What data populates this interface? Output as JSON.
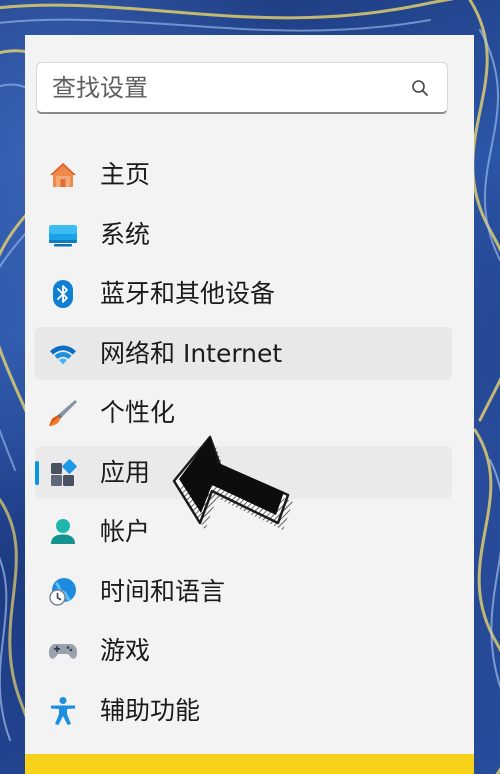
{
  "search": {
    "placeholder": "查找设置"
  },
  "nav": {
    "items": [
      {
        "id": "home",
        "label": "主页",
        "icon": "home-icon"
      },
      {
        "id": "system",
        "label": "系统",
        "icon": "system-display-icon"
      },
      {
        "id": "bluetooth",
        "label": "蓝牙和其他设备",
        "icon": "bluetooth-icon"
      },
      {
        "id": "network",
        "label": "网络和 Internet",
        "icon": "wifi-icon",
        "state": "hover"
      },
      {
        "id": "personalization",
        "label": "个性化",
        "icon": "paintbrush-icon"
      },
      {
        "id": "apps",
        "label": "应用",
        "icon": "apps-icon",
        "state": "selected"
      },
      {
        "id": "accounts",
        "label": "帐户",
        "icon": "account-icon"
      },
      {
        "id": "time-language",
        "label": "时间和语言",
        "icon": "globe-clock-icon"
      },
      {
        "id": "gaming",
        "label": "游戏",
        "icon": "gamepad-icon"
      },
      {
        "id": "accessibility",
        "label": "辅助功能",
        "icon": "accessibility-icon"
      }
    ]
  },
  "colors": {
    "accent": "#0a95d8",
    "panel_bg": "#f3f3f3",
    "highlight_strip": "#f7d21b"
  }
}
